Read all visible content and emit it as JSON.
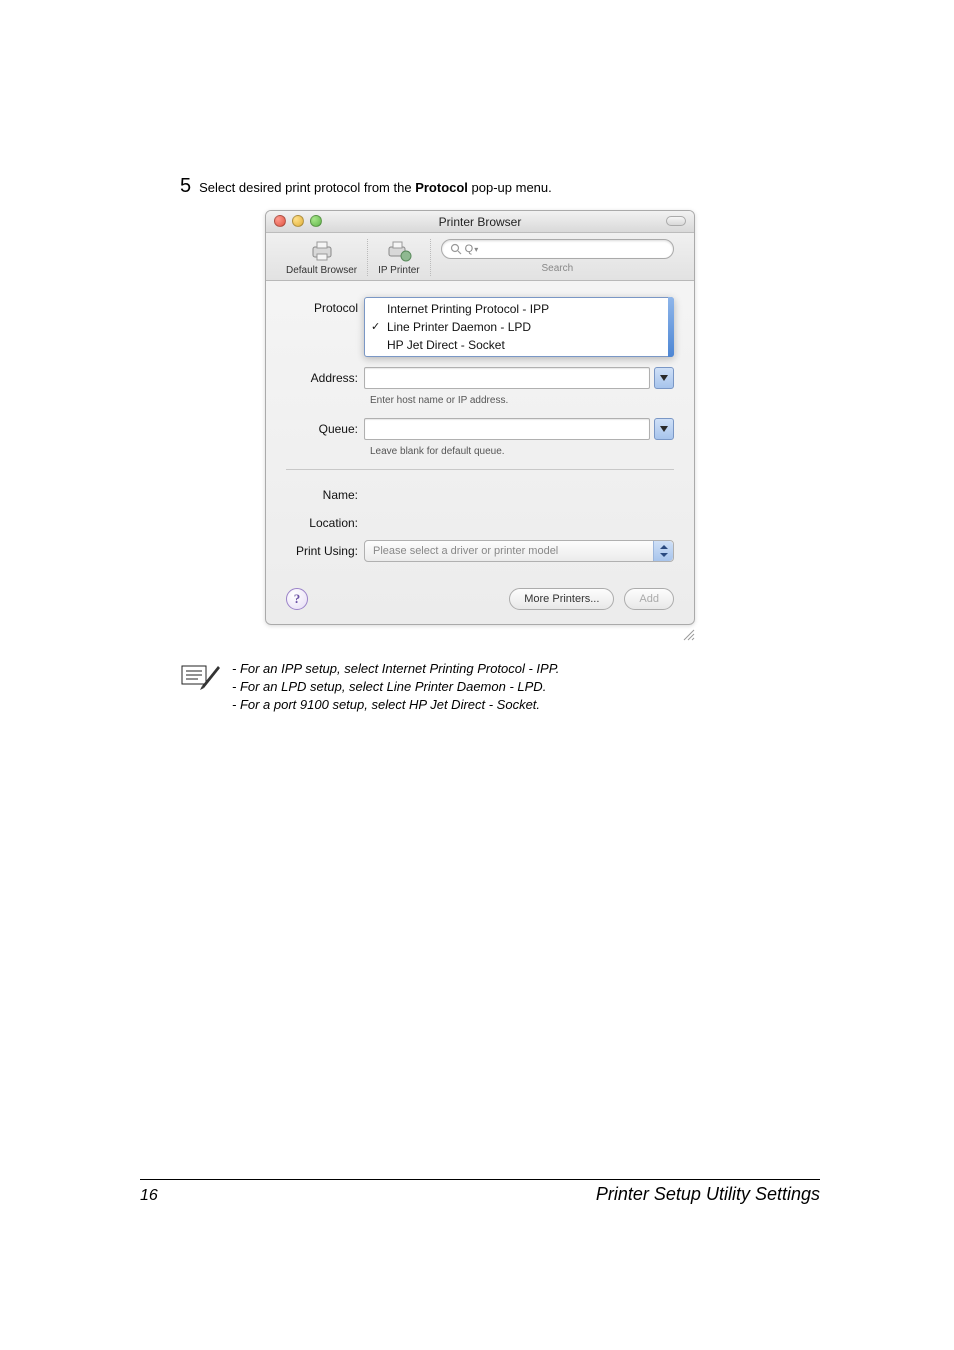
{
  "step": {
    "number": "5",
    "text_before": "Select desired print protocol from the ",
    "bold": "Protocol",
    "text_after": " pop-up menu."
  },
  "dialog": {
    "title": "Printer Browser",
    "toolbar": {
      "default_label": "Default Browser",
      "ip_label": "IP Printer",
      "search_prefix": "Q",
      "search_label": "Search"
    },
    "protocol": {
      "label": "Protocol",
      "options": [
        "Internet Printing Protocol - IPP",
        "Line Printer Daemon - LPD",
        "HP Jet Direct - Socket"
      ],
      "selected_index": 1
    },
    "address": {
      "label": "Address:",
      "hint": "Enter host name or IP address."
    },
    "queue": {
      "label": "Queue:",
      "hint": "Leave blank for default queue."
    },
    "name": {
      "label": "Name:"
    },
    "location": {
      "label": "Location:"
    },
    "print_using": {
      "label": "Print Using:",
      "placeholder": "Please select a driver or printer model"
    },
    "buttons": {
      "help": "?",
      "more": "More Printers...",
      "add": "Add"
    }
  },
  "note": {
    "line1": "- For an IPP setup, select Internet Printing Protocol - IPP.",
    "line2": "- For an LPD setup, select Line Printer Daemon - LPD.",
    "line3": "- For a port 9100 setup, select HP Jet Direct - Socket."
  },
  "footer": {
    "page": "16",
    "title": "Printer Setup Utility Settings"
  }
}
